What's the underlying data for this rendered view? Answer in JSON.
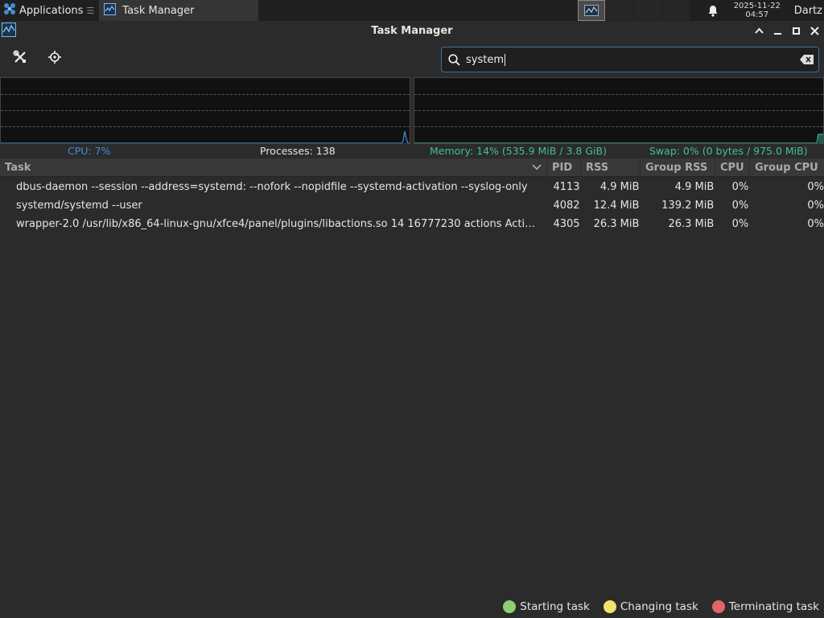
{
  "panel": {
    "apps_label": "Applications",
    "task_label": "Task Manager",
    "clock_date": "2025-11-22",
    "clock_time": "04:57",
    "user": "Dartz"
  },
  "window": {
    "title": "Task Manager"
  },
  "search": {
    "value": "system"
  },
  "status": {
    "cpu": "CPU: 7%",
    "processes": "Processes: 138",
    "memory": "Memory: 14% (535.9 MiB / 3.8 GiB)",
    "swap": "Swap: 0% (0 bytes / 975.0 MiB)"
  },
  "table": {
    "headers": {
      "task": "Task",
      "pid": "PID",
      "rss": "RSS",
      "group_rss": "Group RSS",
      "cpu": "CPU",
      "group_cpu": "Group CPU"
    },
    "rows": [
      {
        "task": "dbus-daemon --session --address=systemd: --nofork --nopidfile --systemd-activation --syslog-only",
        "pid": "4113",
        "rss": "4.9 MiB",
        "group_rss": "4.9 MiB",
        "cpu": "0%",
        "group_cpu": "0%"
      },
      {
        "task": "systemd/systemd --user",
        "pid": "4082",
        "rss": "12.4 MiB",
        "group_rss": "139.2 MiB",
        "cpu": "0%",
        "group_cpu": "0%"
      },
      {
        "task": "wrapper-2.0 /usr/lib/x86_64-linux-gnu/xfce4/panel/plugins/libactions.so 14 16777230 actions Actio…",
        "pid": "4305",
        "rss": "26.3 MiB",
        "group_rss": "26.3 MiB",
        "cpu": "0%",
        "group_cpu": "0%"
      }
    ]
  },
  "legend": {
    "starting": "Starting task",
    "changing": "Changing task",
    "terminating": "Terminating task"
  },
  "colors": {
    "cpu_line": "#3d8fd6",
    "memory_line": "#3fbf9f",
    "starting": "#8fce72",
    "changing": "#f2e36b",
    "terminating": "#e06666"
  }
}
